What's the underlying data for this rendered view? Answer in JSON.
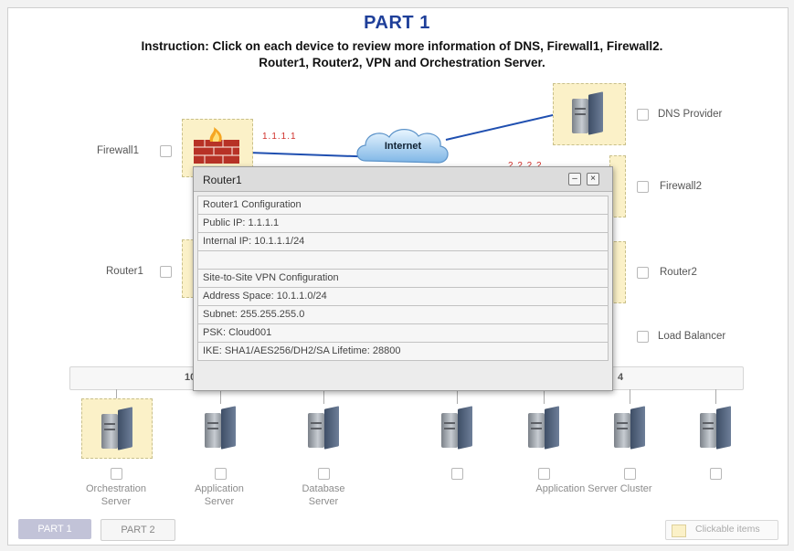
{
  "header": {
    "title": "PART 1",
    "instruction_line1": "Instruction: Click on each device to review more information of DNS, Firewall1, Firewall2.",
    "instruction_line2": "Router1, Router2, VPN and Orchestration Server."
  },
  "network": {
    "cloud_label": "Internet",
    "link_left_ip": "1.1.1.1",
    "link_right_ip": "2.2.2.2",
    "bus_left": "10",
    "bus_right": "4"
  },
  "devices": {
    "firewall1": "Firewall1",
    "router1": "Router1",
    "dns_provider": "DNS Provider",
    "firewall2": "Firewall2",
    "router2": "Router2",
    "load_balancer": "Load Balancer",
    "orchestration_l1": "Orchestration",
    "orchestration_l2": "Server",
    "application_l1": "Application",
    "application_l2": "Server",
    "database_l1": "Database",
    "database_l2": "Server",
    "app_cluster": "Application Server Cluster"
  },
  "popup": {
    "title": "Router1",
    "minimize_label": "–",
    "close_label": "×",
    "rows": [
      "Router1 Configuration",
      "Public IP: 1.1.1.1",
      "Internal IP: 10.1.1.1/24",
      "",
      "Site-to-Site VPN Configuration",
      "Address Space: 10.1.1.0/24",
      "Subnet: 255.255.255.0",
      "PSK: Cloud001",
      "IKE: SHA1/AES256/DH2/SA Lifetime: 28800"
    ]
  },
  "footer": {
    "tab1": "PART 1",
    "tab2": "PART 2",
    "legend": "Clickable items"
  },
  "colors": {
    "title": "#1f3f99",
    "link_line": "#1f4fb0",
    "highlight": "#fbf1c8",
    "ip_red": "#d0302b"
  }
}
